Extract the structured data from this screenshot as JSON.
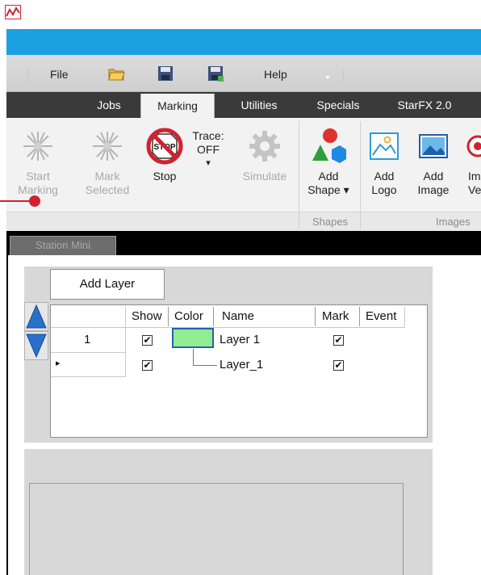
{
  "menu": {
    "file": "File",
    "help": "Help"
  },
  "tabs": [
    {
      "label": "Jobs"
    },
    {
      "label": "Marking"
    },
    {
      "label": "Utilities"
    },
    {
      "label": "Specials"
    },
    {
      "label": "StarFX 2.0"
    }
  ],
  "ribbon": {
    "start_marking": [
      "Start",
      "Marking"
    ],
    "mark_selected": [
      "Mark",
      "Selected"
    ],
    "stop": "Stop",
    "trace": [
      "Trace:",
      "OFF"
    ],
    "trace_arrow": "▾",
    "simulate": "Simulate",
    "add_shape": [
      "Add",
      "Shape ▾"
    ],
    "add_logo": [
      "Add",
      "Logo"
    ],
    "add_image": [
      "Add",
      "Image"
    ],
    "import_vector": [
      "Im",
      "Ve"
    ],
    "stop_icon_text": "STOP",
    "groups": {
      "shapes": "Shapes",
      "images": "Images"
    }
  },
  "document_tab": "Station Mini",
  "layers": {
    "add_layer_label": "Add Layer",
    "columns": [
      "Show",
      "Color",
      "Name",
      "Mark",
      "Event"
    ],
    "rows": [
      {
        "index": "1",
        "show": "✔",
        "name": "Layer 1",
        "mark": "✔"
      },
      {
        "marker": "▸",
        "show": "✔",
        "name": "Layer_1",
        "mark": "✔"
      }
    ]
  },
  "colors": {
    "accent_blue": "#1ba1e2",
    "tab_bar": "#3a3a3a",
    "layer_color": "#90ee90",
    "annotation": "#d1222f"
  }
}
